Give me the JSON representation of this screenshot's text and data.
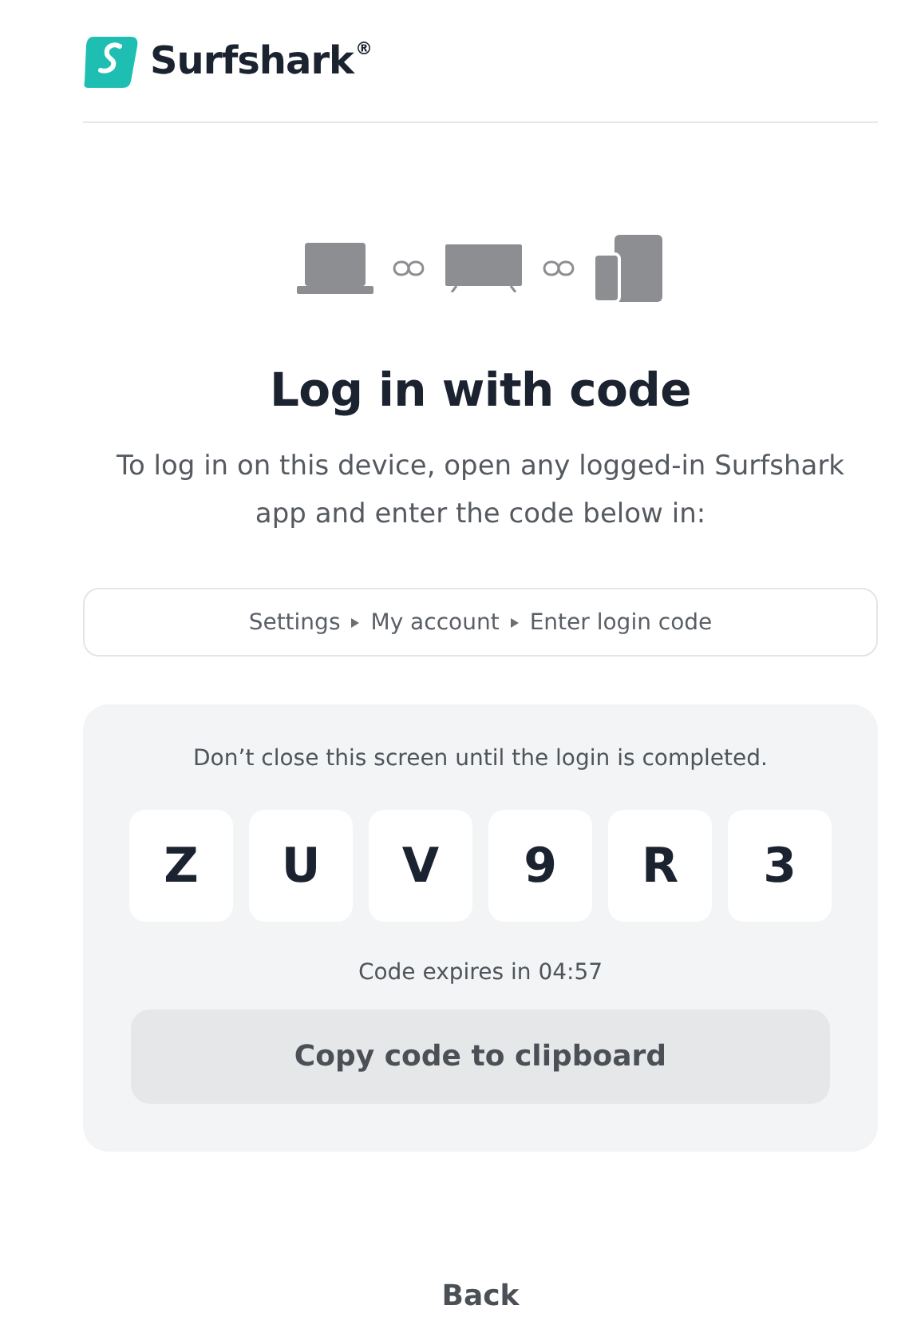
{
  "brand": {
    "name": "Surfshark",
    "mark": "®"
  },
  "title": "Log in with code",
  "instructions": "To log in on this device, open any logged-in Surfshark app and enter the code below in:",
  "path": [
    "Settings",
    "My account",
    "Enter login code"
  ],
  "panel": {
    "notice": "Don’t close this screen until the login is completed.",
    "code": [
      "Z",
      "U",
      "V",
      "9",
      "R",
      "3"
    ],
    "expiry": "Code expires in 04:57",
    "copy_button": "Copy code to clipboard"
  },
  "back_link": "Back"
}
